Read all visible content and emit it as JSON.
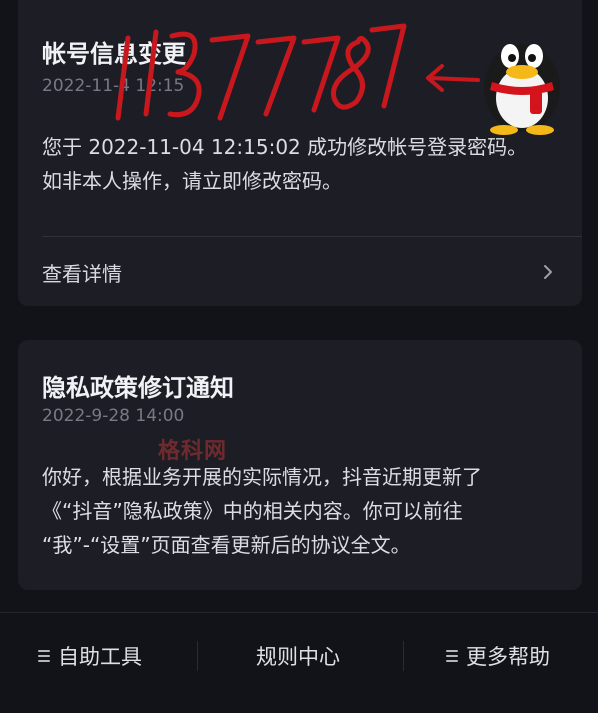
{
  "card1": {
    "title": "帐号信息变更",
    "date": "2022-11-4 12:15",
    "body_line1": "您于 2022-11-04 12:15:02 成功修改帐号登录密码。",
    "body_line2": "如非本人操作，请立即修改密码。",
    "detail_label": "查看详情",
    "handwritten_annotation": "11377787"
  },
  "card2": {
    "title": "隐私政策修订通知",
    "date": "2022-9-28 14:00",
    "body_line1": "你好，根据业务开展的实际情况，抖音近期更新了",
    "body_line2": "《“抖音”隐私政策》中的相关内容。你可以前往",
    "body_line3": "“我”-“设置”页面查看更新后的协议全文。"
  },
  "watermark": "格科网",
  "footer": {
    "self_help": "自助工具",
    "rules_center": "规则中心",
    "more_help": "更多帮助"
  },
  "icons": {
    "chevron": "chevron-right-icon",
    "menu": "menu-lines-icon",
    "penguin": "qq-penguin-icon",
    "arrow": "arrow-left-icon"
  },
  "colors": {
    "background": "#121319",
    "card": "#1d1e25",
    "annotation_red": "#c8181e"
  }
}
